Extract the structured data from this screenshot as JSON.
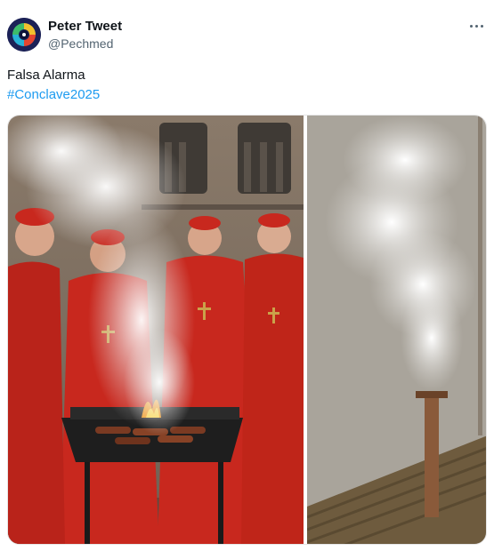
{
  "tweet": {
    "author": {
      "display_name": "Peter Tweet",
      "handle": "@Pechmed",
      "avatar_icon": "swirl-avatar-icon"
    },
    "more_icon": "more-horizontal-icon",
    "text_line": "Falsa Alarma",
    "hashtag": "#Conclave2025",
    "media": [
      {
        "name": "cardinals-barbecue-photo"
      },
      {
        "name": "white-smoke-chimney-photo"
      }
    ]
  },
  "colors": {
    "hashtag": "#1d9bf0",
    "secondary_text": "#536471",
    "cardinal_red": "#c8281e"
  }
}
